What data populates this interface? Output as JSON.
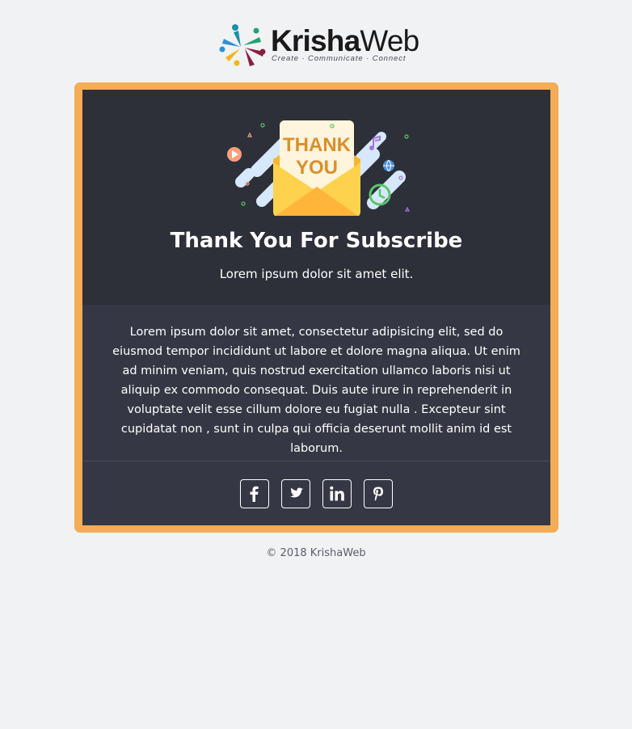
{
  "brand": {
    "name_bold": "Krisha",
    "name_regular": "Web",
    "tagline": "Create · Communicate · Connect"
  },
  "hero": {
    "art_text_line1": "THANK",
    "art_text_line2": "YOU",
    "title": "Thank You For Subscribe",
    "subtitle": "Lorem ipsum dolor sit amet elit."
  },
  "body": {
    "text": "Lorem ipsum dolor sit amet, consectetur adipisicing elit, sed do eiusmod tempor incididunt ut labore et dolore magna aliqua. Ut enim ad minim veniam, quis nostrud exercitation ullamco laboris nisi ut aliquip ex commodo consequat. Duis aute irure in reprehenderit in voluptate velit esse cillum dolore eu fugiat nulla . Excepteur sint cupidatat non , sunt in culpa qui officia deserunt mollit anim id est laborum."
  },
  "social": {
    "items": [
      {
        "icon": "facebook-icon"
      },
      {
        "icon": "twitter-icon"
      },
      {
        "icon": "linkedin-icon"
      },
      {
        "icon": "pinterest-icon"
      }
    ]
  },
  "footer": {
    "copyright": "© 2018 KrishaWeb"
  },
  "colors": {
    "page_background": "#f1f2f4",
    "frame_border": "#f4ac55",
    "hero_background": "#2d3039",
    "card_background": "#353844",
    "text_light": "#ffffff",
    "footer_text": "#5a5e66"
  }
}
